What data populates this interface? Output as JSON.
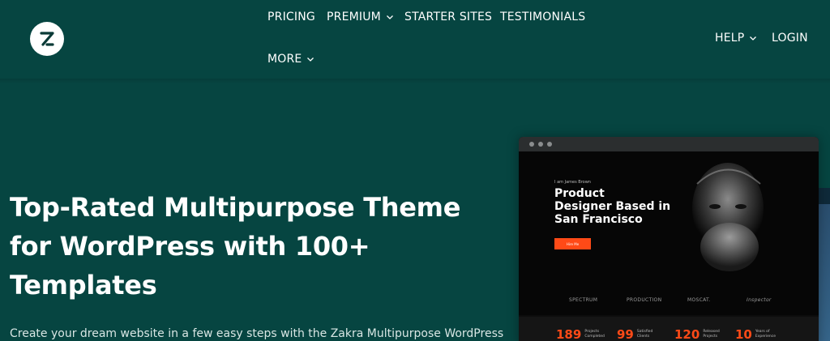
{
  "header": {
    "nav": [
      {
        "label": "PRICING",
        "has_dropdown": false
      },
      {
        "label": "PREMIUM",
        "has_dropdown": true
      },
      {
        "label": "STARTER SITES",
        "has_dropdown": false
      },
      {
        "label": "TESTIMONIALS",
        "has_dropdown": false
      },
      {
        "label": "MORE",
        "has_dropdown": true
      }
    ],
    "right": [
      {
        "label": "HELP",
        "has_dropdown": true
      },
      {
        "label": "LOGIN",
        "has_dropdown": false
      }
    ]
  },
  "hero": {
    "title_lines": [
      "Top-Rated Multipurpose Theme",
      "for WordPress with 100+",
      "Templates"
    ],
    "subtitle": "Create your dream website in a few easy steps with the Zakra Multipurpose WordPress"
  },
  "preview": {
    "small_name": "I am James Brown",
    "headline_lines": [
      "Product",
      "Designer Based in",
      "San Francisco"
    ],
    "button_label": "Hire Me",
    "logos": [
      "SPECTRUM",
      "PRODUCTION",
      "MOSCAT.",
      "Inspector"
    ],
    "stats": [
      {
        "number": "189",
        "label": "Projects Completed"
      },
      {
        "number": "99",
        "label": "Satisfied Clients"
      },
      {
        "number": "120",
        "label": "Released Projects"
      },
      {
        "number": "10",
        "label": "Years of Experience"
      }
    ]
  },
  "colors": {
    "background": "#064541",
    "accent": "#ff4a17",
    "text": "#ffffff"
  }
}
